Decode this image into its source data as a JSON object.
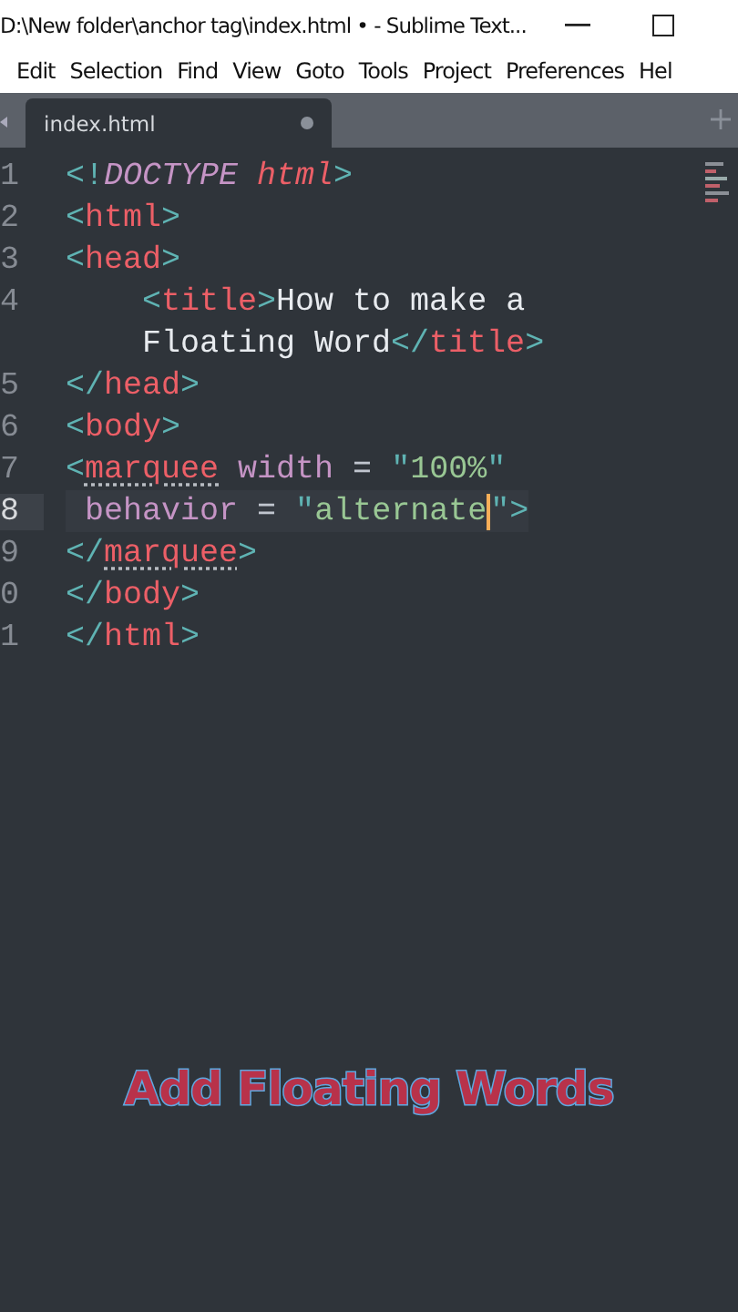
{
  "window": {
    "title": "D:\\New folder\\anchor tag\\index.html • - Sublime Text..."
  },
  "menu": [
    "Edit",
    "Selection",
    "Find",
    "View",
    "Goto",
    "Tools",
    "Project",
    "Preferences",
    "Hel"
  ],
  "tabs": [
    {
      "label": "index.html",
      "selected": true,
      "modified": true
    }
  ],
  "code": {
    "lines": [
      {
        "number": "1",
        "current": false,
        "rows": [
          {
            "tokens": [
              {
                "kind": "punct",
                "text": "<!"
              },
              {
                "kind": "keyword",
                "text": "DOCTYPE "
              },
              {
                "kind": "tag-italic",
                "text": "html"
              },
              {
                "kind": "punct",
                "text": ">"
              }
            ]
          }
        ]
      },
      {
        "number": "2",
        "current": false,
        "rows": [
          {
            "tokens": [
              {
                "kind": "punct",
                "text": "<"
              },
              {
                "kind": "tag",
                "text": "html"
              },
              {
                "kind": "punct",
                "text": ">"
              }
            ]
          }
        ]
      },
      {
        "number": "3",
        "current": false,
        "rows": [
          {
            "tokens": [
              {
                "kind": "punct",
                "text": "<"
              },
              {
                "kind": "tag",
                "text": "head"
              },
              {
                "kind": "punct",
                "text": ">"
              }
            ]
          }
        ]
      },
      {
        "number": "4",
        "current": false,
        "indented": true,
        "rows": [
          {
            "tokens": [
              {
                "kind": "punct",
                "text": "<"
              },
              {
                "kind": "tag",
                "text": "title"
              },
              {
                "kind": "punct",
                "text": ">"
              },
              {
                "kind": "text",
                "text": "How to make a"
              }
            ]
          },
          {
            "tokens": [
              {
                "kind": "text",
                "text": "Floating Word"
              },
              {
                "kind": "punct",
                "text": "</"
              },
              {
                "kind": "tag",
                "text": "title"
              },
              {
                "kind": "punct",
                "text": ">"
              }
            ]
          }
        ]
      },
      {
        "number": "5",
        "current": false,
        "rows": [
          {
            "tokens": [
              {
                "kind": "punct",
                "text": "</"
              },
              {
                "kind": "tag",
                "text": "head"
              },
              {
                "kind": "punct",
                "text": ">"
              }
            ]
          }
        ]
      },
      {
        "number": "6",
        "current": false,
        "rows": [
          {
            "tokens": [
              {
                "kind": "punct",
                "text": "<"
              },
              {
                "kind": "tag",
                "text": "body"
              },
              {
                "kind": "punct",
                "text": ">"
              }
            ]
          }
        ]
      },
      {
        "number": "7",
        "current": false,
        "rows": [
          {
            "tokens": [
              {
                "kind": "punct",
                "text": "<"
              },
              {
                "kind": "tag",
                "text": "marquee",
                "underlined": true
              },
              {
                "kind": "attr",
                "text": " width "
              },
              {
                "kind": "operator",
                "text": "= "
              },
              {
                "kind": "punct",
                "text": "\""
              },
              {
                "kind": "string",
                "text": "100%"
              },
              {
                "kind": "punct",
                "text": "\""
              }
            ]
          }
        ]
      },
      {
        "number": "8",
        "current": true,
        "rows": [
          {
            "tokens": [
              {
                "kind": "attr",
                "text": " behavior "
              },
              {
                "kind": "operator",
                "text": "= "
              },
              {
                "kind": "punct",
                "text": "\""
              },
              {
                "kind": "string",
                "text": "alternate"
              },
              {
                "kind": "caret"
              },
              {
                "kind": "punct",
                "text": "\">"
              }
            ]
          }
        ]
      },
      {
        "number": "9",
        "current": false,
        "rows": [
          {
            "tokens": [
              {
                "kind": "punct",
                "text": "</"
              },
              {
                "kind": "tag",
                "text": "marquee",
                "underlined": true
              },
              {
                "kind": "punct",
                "text": ">"
              }
            ]
          }
        ]
      },
      {
        "number": "0",
        "current": false,
        "rows": [
          {
            "tokens": [
              {
                "kind": "punct",
                "text": "</"
              },
              {
                "kind": "tag",
                "text": "body"
              },
              {
                "kind": "punct",
                "text": ">"
              }
            ]
          }
        ]
      },
      {
        "number": "1",
        "current": false,
        "rows": [
          {
            "tokens": [
              {
                "kind": "punct",
                "text": "</"
              },
              {
                "kind": "tag",
                "text": "html"
              },
              {
                "kind": "punct",
                "text": ">"
              }
            ]
          }
        ]
      }
    ]
  },
  "caption": "Add Floating Words"
}
